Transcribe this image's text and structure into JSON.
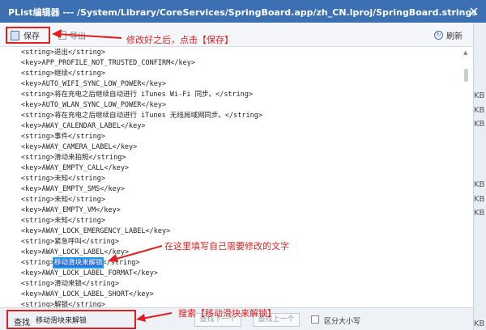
{
  "window": {
    "title": "PList编辑器 --- /System/Library/CoreServices/SpringBoard.app/zh_CN.lproj/SpringBoard.strings",
    "close_glyph": "×"
  },
  "toolbar": {
    "save_label": "保存",
    "export_label": "导出",
    "refresh_label": "刷新"
  },
  "background_sizes": [
    "KB",
    "KB",
    "KB",
    "KB",
    "KB",
    "KB",
    "KB"
  ],
  "editor": {
    "lines": [
      "<string>退出</string>",
      "<key>APP_PROFILE_NOT_TRUSTED_CONFIRM</key>",
      "<string>继续</string>",
      "<key>AUTO_WIFI_SYNC_LOW_POWER</key>",
      "<string>将在充电之后继续自动进行 iTunes Wi-Fi 同步。</string>",
      "<key>AUTO_WLAN_SYNC_LOW_POWER</key>",
      "<string>将在充电之后继续自动进行 iTunes 无线局域网同步。</string>",
      "<key>AWAY_CALENDAR_LABEL</key>",
      "<string>事件</string>",
      "<key>AWAY_CAMERA_LABEL</key>",
      "<string>滑动来拍照</string>",
      "<key>AWAY_EMPTY_CALL</key>",
      "<string>未知</string>",
      "<key>AWAY_EMPTY_SMS</key>",
      "<string>未知</string>",
      "<key>AWAY_EMPTY_VM</key>",
      "<string>未知</string>",
      "<key>AWAY_LOCK_EMERGENCY_LABEL</key>",
      "<string>紧急呼叫</string>",
      "<key>AWAY_LOCK_LABEL</key>",
      "",
      "<key>AWAY_LOCK_LABEL_FORMAT</key>",
      "<string>滑动来锁</string>",
      "<key>AWAY_LOCK_LABEL_SHORT</key>",
      "<string>解锁</string>"
    ],
    "highlight_line": {
      "prefix": "<string>",
      "match": "移动滑块来解锁",
      "suffix": "</string>"
    }
  },
  "search": {
    "label": "查找",
    "value": "移动滑块来解锁",
    "find_next_label": "查找下一个",
    "find_prev_label": "查找上一个",
    "case_sensitive_label": "区分大小写"
  },
  "annotations": {
    "save_note": "修改好之后，点击【保存】",
    "edit_note": "在这里填写自己需要修改的文字",
    "search_note": "搜索【移动滑块来解锁】",
    "color": "#e02020"
  }
}
